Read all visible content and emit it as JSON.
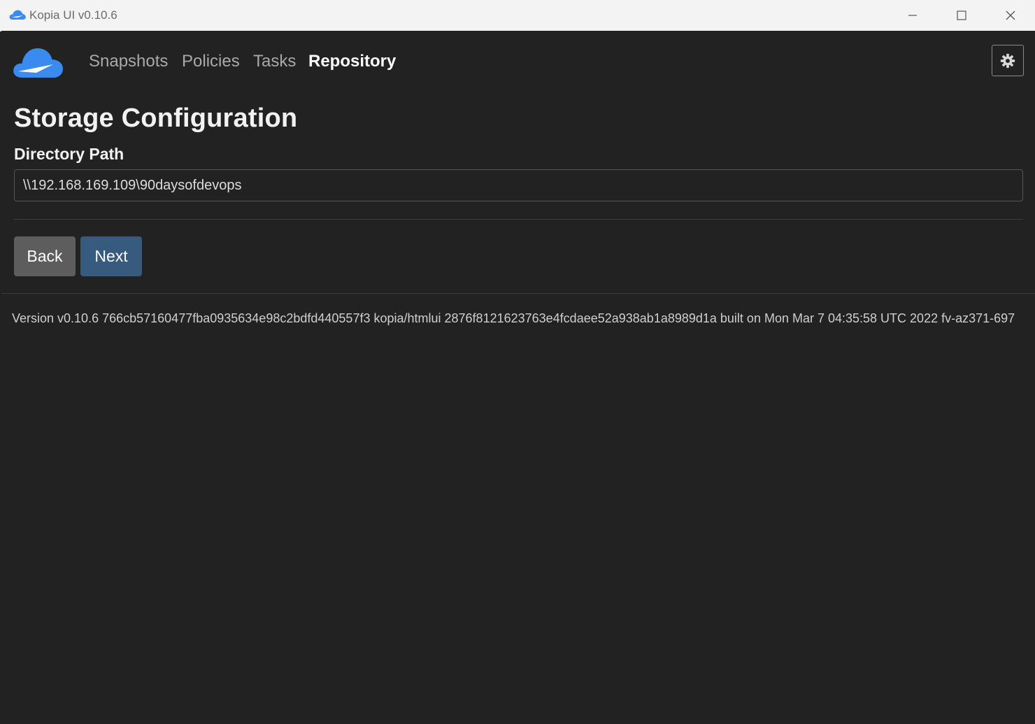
{
  "window": {
    "title": "Kopia UI v0.10.6"
  },
  "nav": {
    "items": [
      {
        "label": "Snapshots",
        "active": false
      },
      {
        "label": "Policies",
        "active": false
      },
      {
        "label": "Tasks",
        "active": false
      },
      {
        "label": "Repository",
        "active": true
      }
    ]
  },
  "page": {
    "title": "Storage Configuration",
    "directory_label": "Directory Path",
    "directory_value": "\\\\192.168.169.109\\90daysofdevops"
  },
  "buttons": {
    "back": "Back",
    "next": "Next"
  },
  "footer": {
    "version_text": "Version v0.10.6 766cb57160477fba0935634e98c2bdfd440557f3 kopia/htmlui 2876f8121623763e4fcdaee52a938ab1a8989d1a built on Mon Mar 7 04:35:58 UTC 2022 fv-az371-697"
  },
  "colors": {
    "background": "#222222",
    "primary_button": "#375a7f",
    "secondary_button": "#5d5d5d",
    "logo_blue": "#3a8bf0"
  },
  "icons": {
    "app": "kopia-cloud-icon",
    "settings": "gear-icon",
    "minimize": "minimize-icon",
    "maximize": "maximize-icon",
    "close": "close-icon"
  }
}
